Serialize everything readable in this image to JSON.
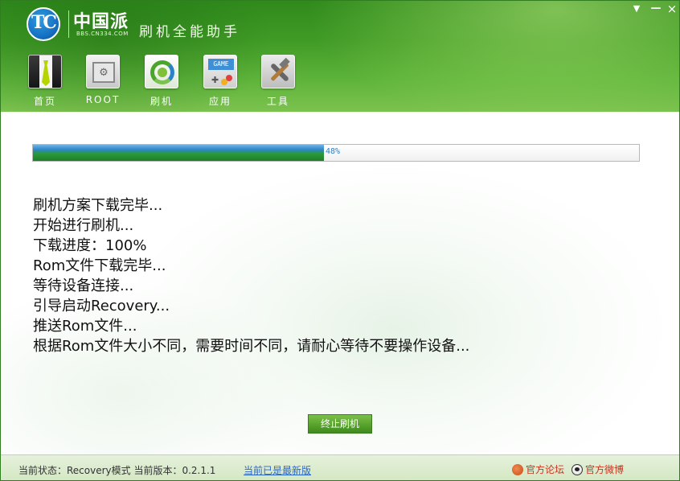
{
  "window": {
    "brand_name": "中国派",
    "brand_sub": "BBS.CN334.COM",
    "title": "刷机全能助手",
    "menu_glyph": "▼",
    "minimize_glyph": "—",
    "close_glyph": "×"
  },
  "nav": [
    {
      "label": "首页",
      "icon": "necktie-icon"
    },
    {
      "label": "ROOT",
      "icon": "root-gear-icon"
    },
    {
      "label": "刷机",
      "icon": "flash-refresh-icon"
    },
    {
      "label": "应用",
      "icon": "gamepad-icon",
      "screen_text": "GAME"
    },
    {
      "label": "工具",
      "icon": "tools-icon"
    }
  ],
  "progress": {
    "value": 0.48,
    "label": "48%"
  },
  "log": [
    "刷机方案下载完毕...",
    "开始进行刷机...",
    "下载进度：100%",
    "Rom文件下载完毕...",
    "等待设备连接...",
    "引导启动Recovery...",
    "推送Rom文件...",
    "根据Rom文件大小不同，需要时间不同，请耐心等待不要操作设备..."
  ],
  "actions": {
    "stop_label": "终止刷机"
  },
  "statusbar": {
    "status": "当前状态：Recovery模式 当前版本：0.2.1.1",
    "update_link": "当前已是最新版",
    "forum_link": "官方论坛",
    "weibo_link": "官方微博"
  },
  "colors": {
    "header_green": "#3f9a25",
    "progress_blue": "#2f86c8",
    "progress_green": "#1f7d2a",
    "button_green": "#58a32c",
    "link_blue": "#2a66c8",
    "link_red": "#d0301e"
  }
}
